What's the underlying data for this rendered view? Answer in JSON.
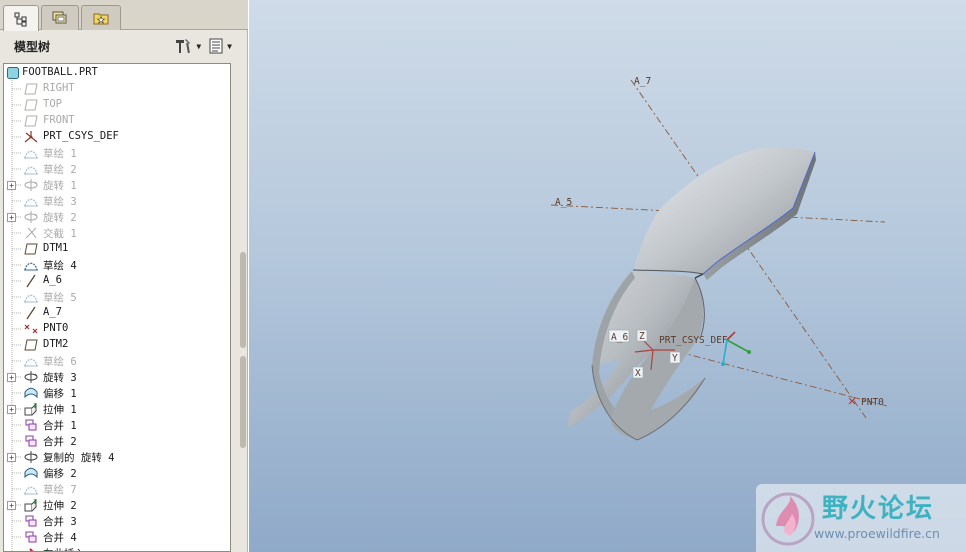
{
  "tabs": [
    {
      "icon": "model-tree-icon",
      "active": true
    },
    {
      "icon": "layers-icon",
      "active": false
    },
    {
      "icon": "favorites-folder-icon",
      "active": false
    }
  ],
  "tree_header": {
    "title": "模型树",
    "tools": [
      {
        "icon": "settings-tools-icon",
        "dropdown": true
      },
      {
        "icon": "show-options-icon",
        "dropdown": true
      }
    ]
  },
  "model_tree": {
    "root": {
      "label": "FOOTBALL.PRT",
      "icon": "part-icon"
    },
    "items": [
      {
        "label": "RIGHT",
        "icon": "datum-plane-icon",
        "suppressed": true,
        "expandable": false
      },
      {
        "label": "TOP",
        "icon": "datum-plane-icon",
        "suppressed": true,
        "expandable": false
      },
      {
        "label": "FRONT",
        "icon": "datum-plane-icon",
        "suppressed": true,
        "expandable": false
      },
      {
        "label": "PRT_CSYS_DEF",
        "icon": "coordinate-system-icon",
        "suppressed": false,
        "expandable": false
      },
      {
        "label": "草绘 1",
        "icon": "sketch-icon",
        "suppressed": true,
        "expandable": false
      },
      {
        "label": "草绘 2",
        "icon": "sketch-icon",
        "suppressed": true,
        "expandable": false
      },
      {
        "label": "旋转 1",
        "icon": "revolve-icon",
        "suppressed": true,
        "expandable": true
      },
      {
        "label": "草绘 3",
        "icon": "sketch-icon",
        "suppressed": true,
        "expandable": false
      },
      {
        "label": "旋转 2",
        "icon": "revolve-icon",
        "suppressed": true,
        "expandable": true
      },
      {
        "label": "交截 1",
        "icon": "intersect-icon",
        "suppressed": true,
        "expandable": false
      },
      {
        "label": "DTM1",
        "icon": "datum-plane-icon",
        "suppressed": false,
        "expandable": false
      },
      {
        "label": "草绘 4",
        "icon": "sketch-icon",
        "suppressed": false,
        "expandable": false
      },
      {
        "label": "A_6",
        "icon": "datum-axis-icon",
        "suppressed": false,
        "expandable": false
      },
      {
        "label": "草绘 5",
        "icon": "sketch-icon",
        "suppressed": true,
        "expandable": false
      },
      {
        "label": "A_7",
        "icon": "datum-axis-icon",
        "suppressed": false,
        "expandable": false
      },
      {
        "label": "PNT0",
        "icon": "datum-point-icon",
        "suppressed": false,
        "expandable": false
      },
      {
        "label": "DTM2",
        "icon": "datum-plane-icon",
        "suppressed": false,
        "expandable": false
      },
      {
        "label": "草绘 6",
        "icon": "sketch-icon",
        "suppressed": true,
        "expandable": false
      },
      {
        "label": "旋转 3",
        "icon": "revolve-icon",
        "suppressed": false,
        "expandable": true
      },
      {
        "label": "偏移 1",
        "icon": "offset-icon",
        "suppressed": false,
        "expandable": false
      },
      {
        "label": "拉伸 1",
        "icon": "extrude-icon",
        "suppressed": false,
        "expandable": true
      },
      {
        "label": "合并 1",
        "icon": "merge-icon",
        "suppressed": false,
        "expandable": false
      },
      {
        "label": "合并 2",
        "icon": "merge-icon",
        "suppressed": false,
        "expandable": false
      },
      {
        "label": "复制的 旋转 4",
        "icon": "revolve-icon",
        "suppressed": false,
        "expandable": true
      },
      {
        "label": "偏移 2",
        "icon": "offset-icon",
        "suppressed": false,
        "expandable": false
      },
      {
        "label": "草绘 7",
        "icon": "sketch-icon",
        "suppressed": true,
        "expandable": false
      },
      {
        "label": "拉伸 2",
        "icon": "extrude-icon",
        "suppressed": false,
        "expandable": true
      },
      {
        "label": "合并 3",
        "icon": "merge-icon",
        "suppressed": false,
        "expandable": false
      },
      {
        "label": "合并 4",
        "icon": "merge-icon",
        "suppressed": false,
        "expandable": false
      },
      {
        "label": "在此插入",
        "icon": "insert-here-arrow-icon",
        "suppressed": false,
        "expandable": false
      }
    ]
  },
  "viewport": {
    "datum_labels": {
      "axis_a7": "A_7",
      "axis_a5": "A_5",
      "axis_a6": "A_6",
      "csys": "PRT_CSYS_DEF",
      "point": "PNT0",
      "csys_x": "X",
      "csys_y": "Y",
      "csys_z": "Z"
    },
    "colors": {
      "background_top": "#cfdbe8",
      "background_bottom": "#8fa9c8",
      "datum_line": "#8a5a3a",
      "surface_edge": "#4a6ad0"
    }
  },
  "watermark": {
    "title": "野火论坛",
    "url": "www.proewildfire.cn"
  }
}
